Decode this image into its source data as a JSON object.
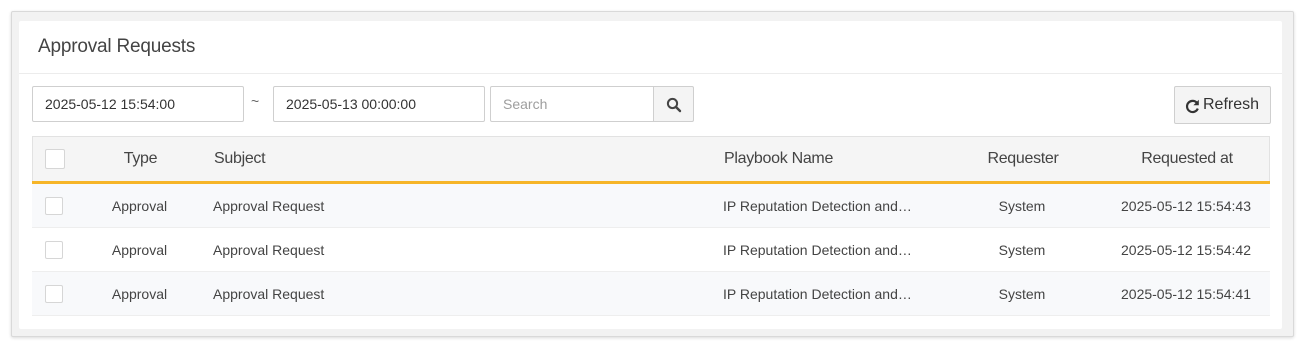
{
  "panel": {
    "title": "Approval Requests"
  },
  "filters": {
    "date_from": "2025-05-12 15:54:00",
    "separator": "~",
    "date_to": "2025-05-13 00:00:00",
    "search_placeholder": "Search"
  },
  "toolbar": {
    "refresh_label": "Refresh"
  },
  "table": {
    "columns": {
      "type": "Type",
      "subject": "Subject",
      "playbook": "Playbook Name",
      "requester": "Requester",
      "requested_at": "Requested at"
    },
    "rows": [
      {
        "type": "Approval",
        "subject": "Approval Request",
        "playbook": "IP Reputation Detection and…",
        "requester": "System",
        "requested_at": "2025-05-12 15:54:43"
      },
      {
        "type": "Approval",
        "subject": "Approval Request",
        "playbook": "IP Reputation Detection and…",
        "requester": "System",
        "requested_at": "2025-05-12 15:54:42"
      },
      {
        "type": "Approval",
        "subject": "Approval Request",
        "playbook": "IP Reputation Detection and…",
        "requester": "System",
        "requested_at": "2025-05-12 15:54:41"
      }
    ]
  },
  "icons": {
    "search": "search-icon",
    "refresh": "refresh-icon"
  },
  "colors": {
    "accent_line": "#f6b528",
    "header_bg": "#f5f5f5",
    "button_bg": "#f4f4f4"
  }
}
